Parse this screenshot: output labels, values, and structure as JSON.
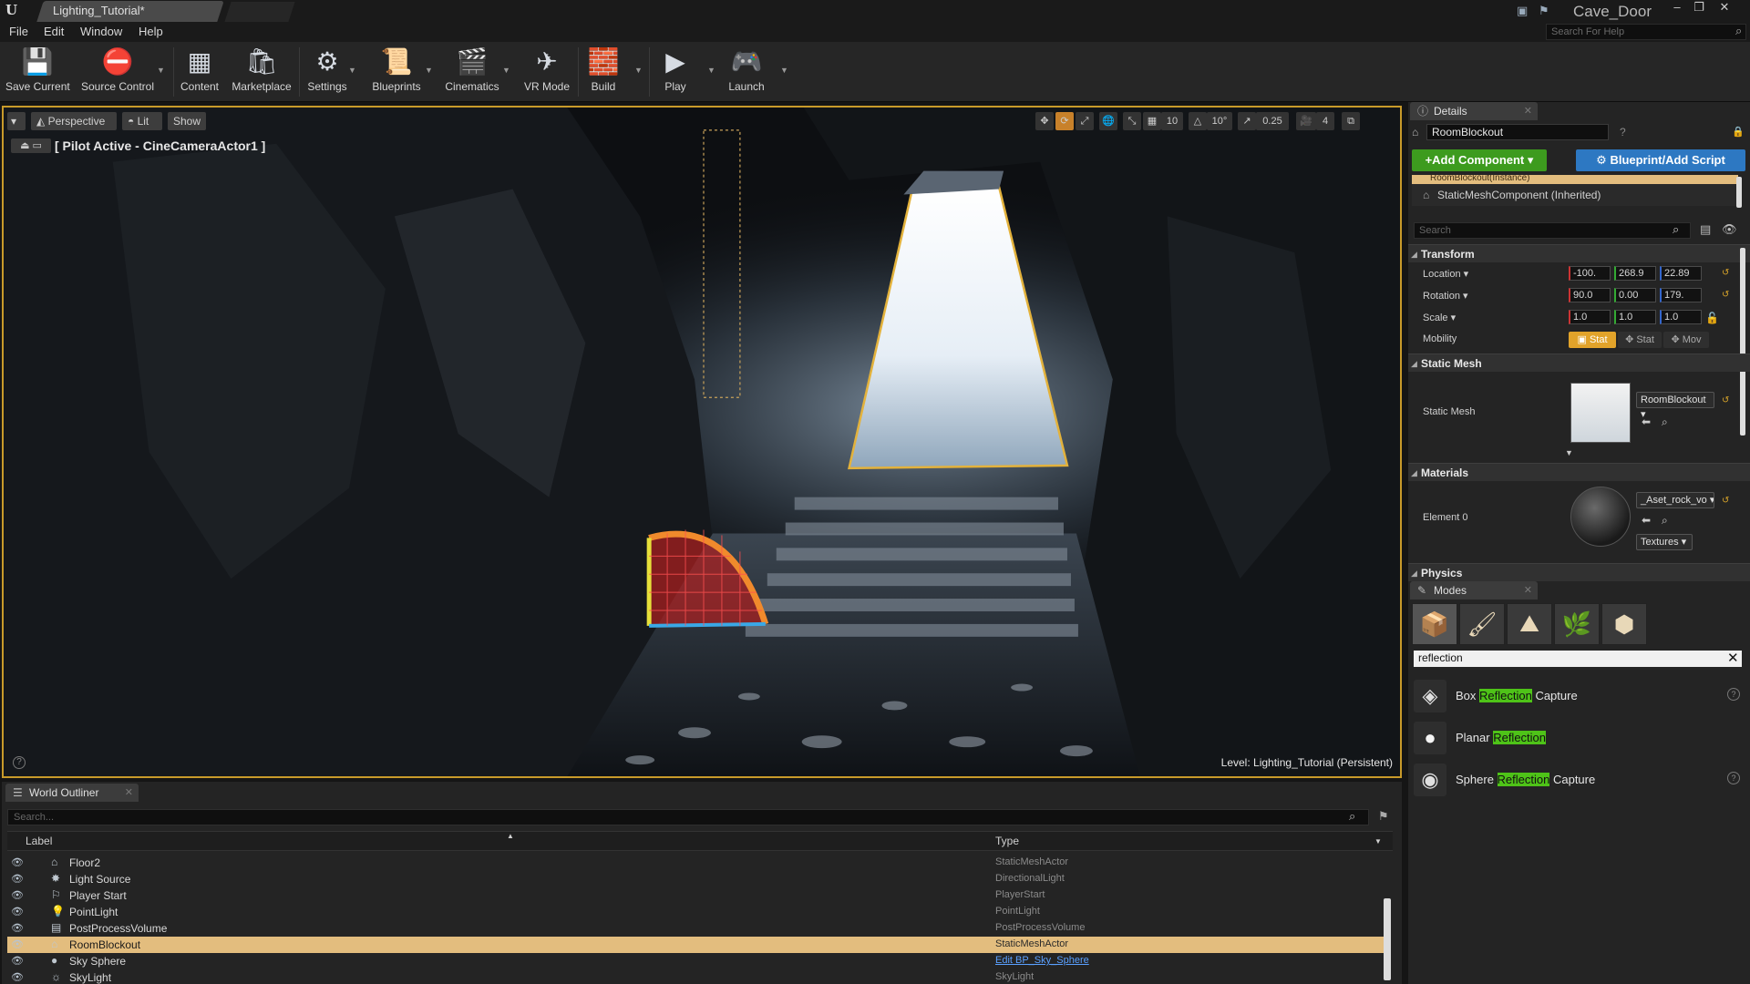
{
  "window": {
    "doc_tab": "Lighting_Tutorial*",
    "project": "Cave_Door"
  },
  "menu": [
    "File",
    "Edit",
    "Window",
    "Help"
  ],
  "help_search_placeholder": "Search For Help",
  "toolbar": {
    "buttons": [
      "Save Current",
      "Source Control",
      "Content",
      "Marketplace",
      "Settings",
      "Blueprints",
      "Cinematics",
      "VR Mode",
      "Build",
      "Play",
      "Launch"
    ]
  },
  "viewport": {
    "perspective": "Perspective",
    "lit": "Lit",
    "show": "Show",
    "pilot_label": "[ Pilot Active - CineCameraActor1 ]",
    "grid_snap": "10",
    "rot_snap": "10°",
    "scale_snap": "0.25",
    "camera_speed": "4",
    "level_label": "Level:",
    "level_name": "Lighting_Tutorial (Persistent)"
  },
  "outliner": {
    "tab": "World Outliner",
    "search_placeholder": "Search...",
    "col_label": "Label",
    "col_type": "Type",
    "rows": [
      {
        "label": "Floor2",
        "type": "StaticMeshActor",
        "icon": "mesh-icon"
      },
      {
        "label": "Light Source",
        "type": "DirectionalLight",
        "icon": "sun-icon"
      },
      {
        "label": "Player Start",
        "type": "PlayerStart",
        "icon": "flag-icon"
      },
      {
        "label": "PointLight",
        "type": "PointLight",
        "icon": "bulb-icon"
      },
      {
        "label": "PostProcessVolume",
        "type": "PostProcessVolume",
        "icon": "volume-icon"
      },
      {
        "label": "RoomBlockout",
        "type": "StaticMeshActor",
        "icon": "mesh-icon",
        "selected": true
      },
      {
        "label": "Sky Sphere",
        "type": "Edit BP_Sky_Sphere",
        "icon": "sphere-icon",
        "link": true
      },
      {
        "label": "SkyLight",
        "type": "SkyLight",
        "icon": "skylight-icon"
      }
    ]
  },
  "details": {
    "tab": "Details",
    "actor_name": "RoomBlockout",
    "add_component": "+Add Component",
    "blueprint": "Blueprint/Add Script",
    "instance_row": "RoomBlockout(Instance)",
    "component_row": "StaticMeshComponent (Inherited)",
    "search_placeholder": "Search",
    "transform": {
      "title": "Transform",
      "location_label": "Location",
      "rotation_label": "Rotation",
      "scale_label": "Scale",
      "mobility_label": "Mobility",
      "location": [
        "-100.",
        "268.9",
        "22.89"
      ],
      "rotation": [
        "90.0",
        "0.00",
        "179."
      ],
      "scale": [
        "1.0",
        "1.0",
        "1.0"
      ],
      "mobility": [
        "Stat",
        "Stat",
        "Mov"
      ]
    },
    "static_mesh": {
      "title": "Static Mesh",
      "label": "Static Mesh",
      "value": "RoomBlockout"
    },
    "materials": {
      "title": "Materials",
      "label": "Element 0",
      "value": "_Aset_rock_vo",
      "textures": "Textures"
    },
    "physics_title": "Physics"
  },
  "modes": {
    "tab": "Modes",
    "search_value": "reflection",
    "items": [
      {
        "pre": "Box ",
        "hl": "Reflection",
        "post": " Capture",
        "help": "?"
      },
      {
        "pre": "Planar ",
        "hl": "Reflection",
        "post": "",
        "help": ""
      },
      {
        "pre": "Sphere ",
        "hl": "Reflection",
        "post": " Capture",
        "help": "?"
      }
    ]
  },
  "colors": {
    "selection": "#e3bd7e",
    "add_component": "#3d9b1e",
    "blueprint": "#2d78c2",
    "viewport_border": "#c89a2a",
    "search_highlight": "#4ec318"
  }
}
